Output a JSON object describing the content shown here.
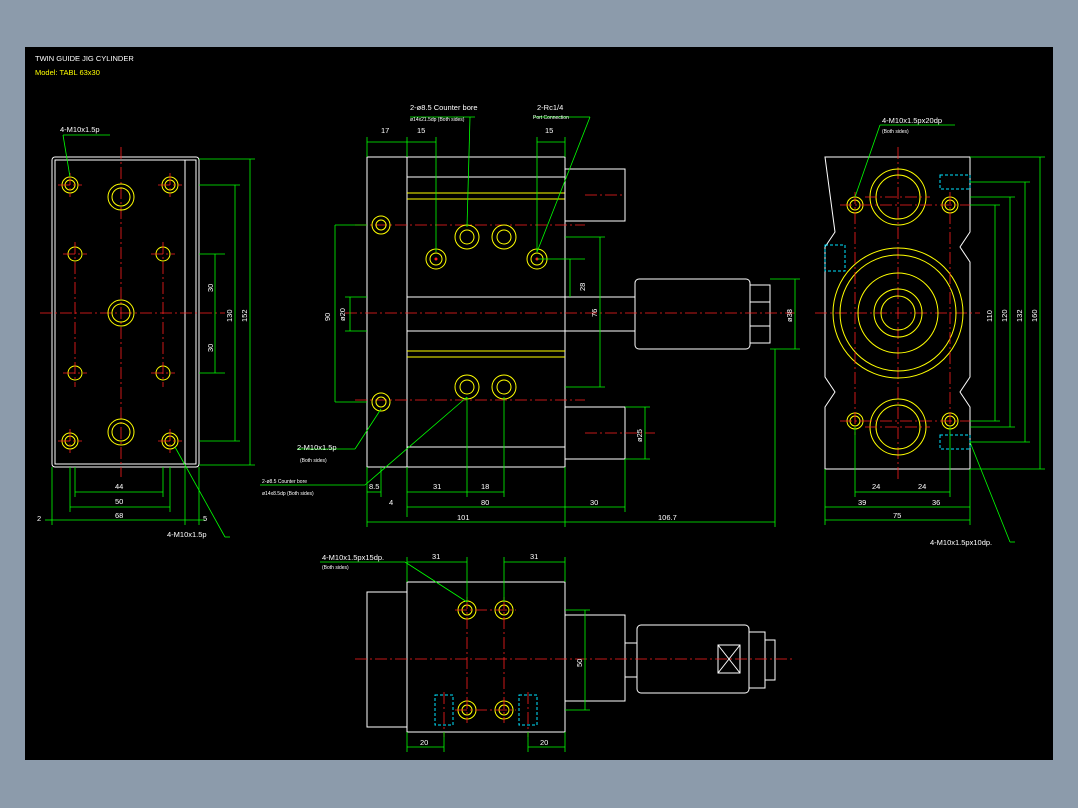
{
  "header": {
    "title": "TWIN GUIDE JIG CYLINDER",
    "model": "Model: TABL 63x30"
  },
  "left_view": {
    "callout_top": "4-M10x1.5p",
    "callout_bottom": "4-M10x1.5p",
    "dims": {
      "d30a": "30",
      "d130": "130",
      "d152": "152",
      "d30b": "30",
      "d44": "44",
      "d50": "50",
      "d68": "68",
      "d2": "2",
      "d5": "5"
    }
  },
  "front_view": {
    "callout_cb": "2-ø8.5 Counter bore",
    "callout_cb2": "ø14x21.5dp (Both sides)",
    "callout_port": "2-Rc1/4",
    "callout_port2": "Port Connection",
    "callout_m10": "2-M10x1.5p",
    "callout_m10b": "(Both sides)",
    "callout_cb3": "2-ø8.5 Counter bore",
    "callout_cb4": "ø14x8.5dp (Both sides)",
    "dims": {
      "d17": "17",
      "d15a": "15",
      "d15b": "15",
      "d90": "90",
      "d20": "ø20",
      "d28": "28",
      "d76": "76",
      "d38": "ø38",
      "d25": "ø25",
      "d85": "8.5",
      "d4": "4",
      "d31": "31",
      "d18": "18",
      "d80": "80",
      "d30": "30",
      "d101": "101",
      "d1067": "106.7"
    }
  },
  "right_view": {
    "callout_top": "4-M10x1.5px20dp",
    "callout_top2": "(Both sides)",
    "callout_bottom": "4-M10x1.5px10dp.",
    "dims": {
      "d110": "110",
      "d120": "120",
      "d132": "132",
      "d160": "160",
      "d24a": "24",
      "d24b": "24",
      "d39": "39",
      "d36": "36",
      "d75": "75"
    }
  },
  "bottom_view": {
    "callout": "4-M10x1.5px15dp.",
    "callout2": "(Both sides)",
    "dims": {
      "d31a": "31",
      "d31b": "31",
      "d50": "50",
      "d20a": "20",
      "d20b": "20"
    }
  }
}
